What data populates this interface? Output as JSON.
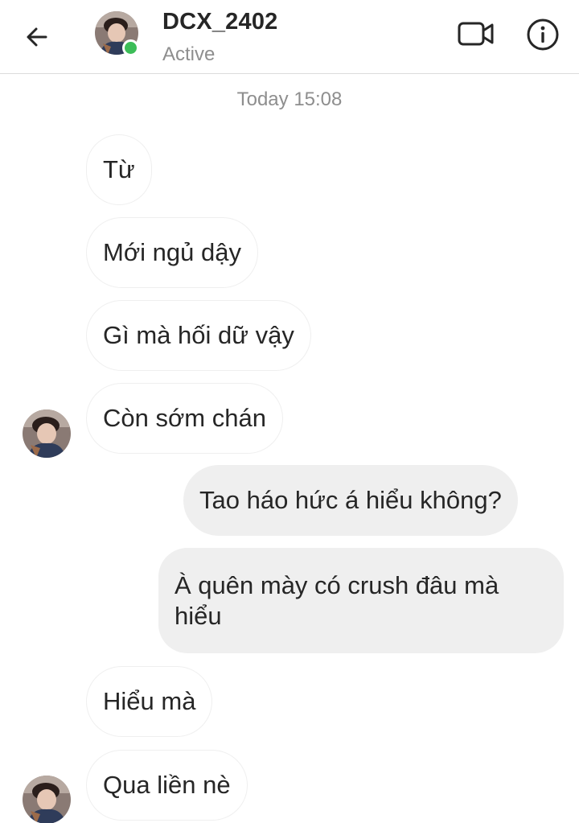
{
  "header": {
    "username": "DCX_2402",
    "status": "Active",
    "status_color": "#3cbd58"
  },
  "icons": {
    "back": "arrow-left-icon",
    "video": "video-camera-icon",
    "info": "info-circle-icon"
  },
  "thread": {
    "timestamp": "Today 15:08",
    "messages": [
      {
        "direction": "incoming",
        "text": "Từ"
      },
      {
        "direction": "incoming",
        "text": "Mới ngủ dậy"
      },
      {
        "direction": "incoming",
        "text": "Gì mà hối dữ vậy"
      },
      {
        "direction": "incoming",
        "text": "Còn sớm chán"
      },
      {
        "direction": "outgoing",
        "text": "Tao háo hức á hiểu không?"
      },
      {
        "direction": "outgoing",
        "text": "À quên mày có crush đâu mà hiểu"
      },
      {
        "direction": "incoming",
        "text": "Hiểu mà"
      },
      {
        "direction": "incoming",
        "text": "Qua liền nè"
      }
    ]
  }
}
